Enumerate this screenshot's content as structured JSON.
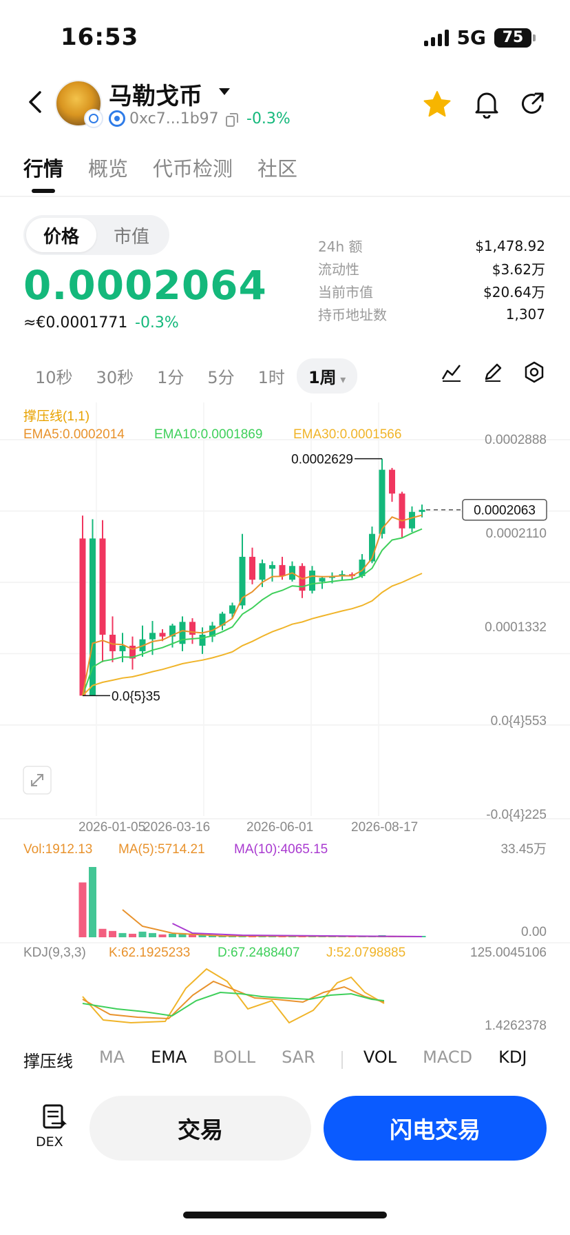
{
  "status": {
    "time": "16:53",
    "network": "5G",
    "battery": "75"
  },
  "token": {
    "name": "马勒戈币",
    "address": "0xc7...1b97",
    "change": "-0.3%"
  },
  "tabs": [
    "行情",
    "概览",
    "代币检测",
    "社区"
  ],
  "price_toggle": {
    "price": "价格",
    "market_cap": "市值"
  },
  "price": {
    "value": "0.0002064",
    "fiat": "≈€0.0001771",
    "change": "-0.3%"
  },
  "stats": [
    {
      "label": "24h  额",
      "value": "$1,478.92"
    },
    {
      "label": "流动性",
      "value": "$3.62万"
    },
    {
      "label": "当前市值",
      "value": "$20.64万"
    },
    {
      "label": "持币地址数",
      "value": "1,307"
    }
  ],
  "intervals": [
    "10秒",
    "30秒",
    "1分",
    "5分",
    "1时",
    "1周"
  ],
  "active_interval": "1周",
  "indicators": {
    "sr_label": "撑压线(1,1)",
    "ema5": "EMA5:0.0002014",
    "ema10": "EMA10:0.0001869",
    "ema30": "EMA30:0.0001566",
    "y_ticks": [
      "0.0002888",
      "0.0002110",
      "0.0001332",
      "0.0{4}553",
      "-0.0{4}225"
    ],
    "high_label": "0.0002629",
    "low_label": "0.0{5}35",
    "last_price": "0.0002063",
    "x_ticks": [
      "2026-01-05",
      "2026-03-16",
      "2026-06-01",
      "2026-08-17"
    ],
    "vol": "Vol:1912.13",
    "vol_ma5": "MA(5):5714.21",
    "vol_ma10": "MA(10):4065.15",
    "vol_max": "33.45万",
    "vol_min": "0.00",
    "kdj": "KDJ(9,3,3)",
    "kdj_k": "K:62.1925233",
    "kdj_d": "D:67.2488407",
    "kdj_j": "J:52.0798885",
    "kdj_max": "125.0045106",
    "kdj_min": "1.4262378"
  },
  "bottom_tabs": [
    "撑压线",
    "MA",
    "EMA",
    "BOLL",
    "SAR",
    "VOL",
    "MACD",
    "KDJ"
  ],
  "bottom_bar": {
    "dex": "DEX",
    "trade": "交易",
    "flash_trade": "闪电交易"
  },
  "colors": {
    "up": "#14b87b",
    "down": "#f0365f",
    "ema5": "#e8922c",
    "ema10": "#3ecf5a",
    "ema30": "#f0b429",
    "primary": "#0a5bff"
  },
  "chart_data": {
    "type": "candlestick",
    "interval": "1周",
    "ylim": [
      -2.25e-05,
      0.0002888
    ],
    "x_ticks": [
      "2026-01-05",
      "2026-03-16",
      "2026-06-01",
      "2026-08-17"
    ],
    "candles": [
      {
        "o": 0.000175,
        "h": 0.0002,
        "l": 3.5e-06,
        "c": 3.5e-06
      },
      {
        "o": 3.5e-06,
        "h": 0.000196,
        "l": 3.5e-06,
        "c": 0.000175
      },
      {
        "o": 0.000175,
        "h": 0.000195,
        "l": 4e-05,
        "c": 7e-05
      },
      {
        "o": 7e-05,
        "h": 9e-05,
        "l": 4e-05,
        "c": 5.2e-05
      },
      {
        "o": 5.2e-05,
        "h": 7.2e-05,
        "l": 4e-05,
        "c": 5.8e-05
      },
      {
        "o": 5.8e-05,
        "h": 6.8e-05,
        "l": 3.2e-05,
        "c": 4.4e-05
      },
      {
        "o": 5.2e-05,
        "h": 8e-05,
        "l": 4.6e-05,
        "c": 6.5e-05
      },
      {
        "o": 6.5e-05,
        "h": 8.5e-05,
        "l": 4.8e-05,
        "c": 7.2e-05
      },
      {
        "o": 7.2e-05,
        "h": 7.6e-05,
        "l": 6.3e-05,
        "c": 6.8e-05
      },
      {
        "o": 6.8e-05,
        "h": 8.2e-05,
        "l": 5.6e-05,
        "c": 8e-05
      },
      {
        "o": 6e-05,
        "h": 9e-05,
        "l": 5.2e-05,
        "c": 8.4e-05
      },
      {
        "o": 8.4e-05,
        "h": 8.8e-05,
        "l": 6e-05,
        "c": 7e-05
      },
      {
        "o": 5.8e-05,
        "h": 7.8e-05,
        "l": 4.9e-05,
        "c": 7e-05
      },
      {
        "o": 6.8e-05,
        "h": 8.4e-05,
        "l": 6.2e-05,
        "c": 8e-05
      },
      {
        "o": 8e-05,
        "h": 9.5e-05,
        "l": 7.5e-05,
        "c": 9.3e-05
      },
      {
        "o": 9.3e-05,
        "h": 0.000105,
        "l": 8.8e-05,
        "c": 0.000102
      },
      {
        "o": 0.000102,
        "h": 0.00018,
        "l": 9.8e-05,
        "c": 0.000155
      },
      {
        "o": 0.000155,
        "h": 0.000165,
        "l": 0.000125,
        "c": 0.00013
      },
      {
        "o": 0.00013,
        "h": 0.000152,
        "l": 0.000122,
        "c": 0.000148
      },
      {
        "o": 0.000142,
        "h": 0.00015,
        "l": 0.000128,
        "c": 0.000146
      },
      {
        "o": 0.000146,
        "h": 0.000155,
        "l": 0.00013,
        "c": 0.000134
      },
      {
        "o": 0.00013,
        "h": 0.00015,
        "l": 0.000128,
        "c": 0.000145
      },
      {
        "o": 0.000145,
        "h": 0.000148,
        "l": 0.00011,
        "c": 0.000118
      },
      {
        "o": 0.000118,
        "h": 0.000145,
        "l": 0.000115,
        "c": 0.00014
      },
      {
        "o": 0.000128,
        "h": 0.000134,
        "l": 0.00012,
        "c": 0.000132
      },
      {
        "o": 0.000132,
        "h": 0.000138,
        "l": 0.000126,
        "c": 0.000134
      },
      {
        "o": 0.000134,
        "h": 0.00014,
        "l": 0.00013,
        "c": 0.000136
      },
      {
        "o": 0.000136,
        "h": 0.000138,
        "l": 0.00013,
        "c": 0.000134
      },
      {
        "o": 0.000134,
        "h": 0.000158,
        "l": 0.000132,
        "c": 0.000152
      },
      {
        "o": 0.00015,
        "h": 0.000188,
        "l": 0.000148,
        "c": 0.00018
      },
      {
        "o": 0.00018,
        "h": 0.000262,
        "l": 0.000175,
        "c": 0.00025
      },
      {
        "o": 0.00025,
        "h": 0.000252,
        "l": 0.000215,
        "c": 0.000224
      },
      {
        "o": 0.000224,
        "h": 0.000226,
        "l": 0.000176,
        "c": 0.000186
      },
      {
        "o": 0.000186,
        "h": 0.00021,
        "l": 0.000182,
        "c": 0.000204
      },
      {
        "o": 0.000204,
        "h": 0.000212,
        "l": 0.000198,
        "c": 0.0002063
      }
    ]
  }
}
